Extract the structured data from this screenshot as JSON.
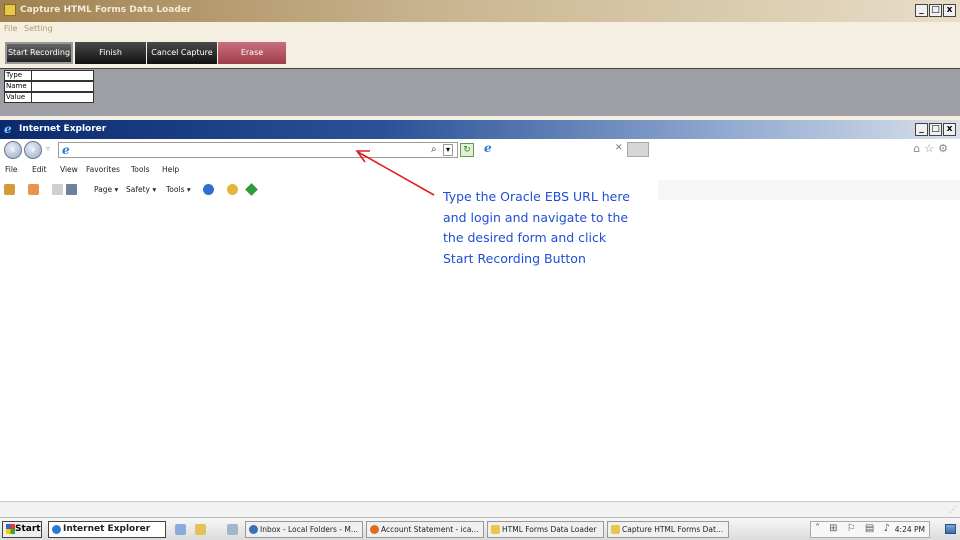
{
  "capture_app": {
    "title": "Capture HTML Forms Data Loader",
    "menu": [
      "File",
      "Setting"
    ],
    "buttons": {
      "start": "Start Recording",
      "finish": "Finish",
      "cancel": "Cancel Capture",
      "erase": "Erase"
    },
    "fields": [
      {
        "label": "Type",
        "value": ""
      },
      {
        "label": "Name",
        "value": ""
      },
      {
        "label": "Value",
        "value": ""
      }
    ]
  },
  "window_controls": {
    "minimize": "_",
    "maximize": "□",
    "close": "x"
  },
  "ie": {
    "title": "Internet Explorer",
    "address_value": "",
    "menu": [
      "File",
      "Edit",
      "View",
      "Favorites",
      "Tools",
      "Help"
    ],
    "command_bar": {
      "page": "Page ▾",
      "safety": "Safety ▾",
      "tools": "Tools ▾"
    }
  },
  "annotation": {
    "lines": [
      "Type the Oracle EBS URL here",
      "and login and navigate to the",
      "the desired form and click",
      "Start Recording Button"
    ],
    "color": "#1f4ed8",
    "arrow_color": "#e02020"
  },
  "taskbar": {
    "start_label": "Start",
    "tasks": [
      {
        "label": "Internet Explorer",
        "icon": "ie-icon"
      },
      {
        "label": "Inbox - Local Folders - M...",
        "icon": "thunderbird-icon"
      },
      {
        "label": "Account Statement - ica...",
        "icon": "firefox-icon"
      },
      {
        "label": "HTML Forms Data Loader",
        "icon": "app-icon"
      },
      {
        "label": "Capture HTML Forms Dat...",
        "icon": "app-icon"
      }
    ],
    "clock": "4:24 PM"
  }
}
